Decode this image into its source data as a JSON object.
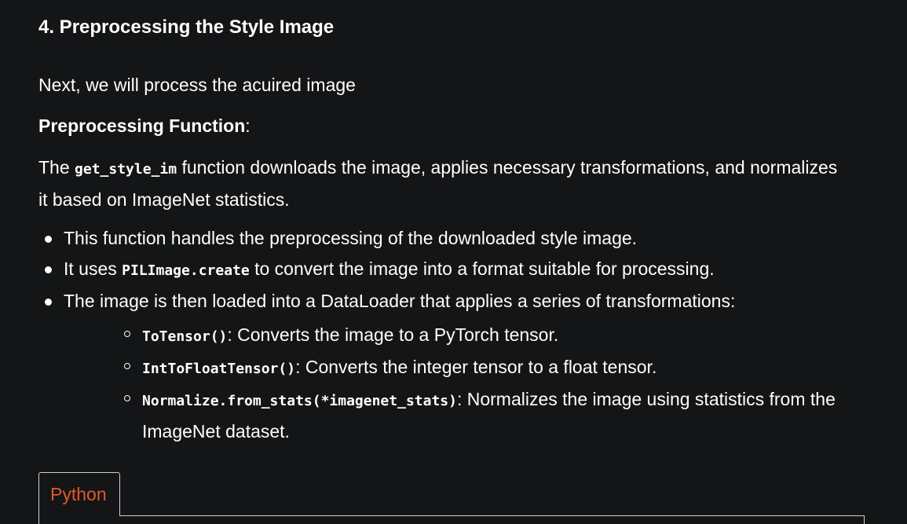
{
  "heading": "4. Preprocessing the Style Image",
  "intro": "Next, we will process the acuired image",
  "function_label": {
    "bold": "Preprocessing Function",
    "colon": ":"
  },
  "description": {
    "before": "The ",
    "code": "get_style_im",
    "after": " function downloads the image, applies necessary transformations, and normalizes it based on ImageNet statistics."
  },
  "bullets": [
    {
      "text": "This function handles the preprocessing of the downloaded style image."
    },
    {
      "before": "It uses ",
      "code": "PILImage.create",
      "after": " to convert the image into a format suitable for processing."
    },
    {
      "text": "The image is then loaded into a DataLoader that applies a series of transformations:"
    }
  ],
  "sub_bullets": [
    {
      "code": "ToTensor()",
      "after": ": Converts the image to a PyTorch tensor."
    },
    {
      "code": "IntToFloatTensor()",
      "after": ": Converts the integer tensor to a float tensor."
    },
    {
      "code": "Normalize.from_stats(*imagenet_stats)",
      "after": ": Normalizes the image using statistics from the ImageNet dataset."
    }
  ],
  "code_block": {
    "tab_label": "Python",
    "accent_color": "#e4582a"
  },
  "colors": {
    "background": "#141517",
    "text": "#ffffff",
    "border": "#cfcfcf"
  }
}
